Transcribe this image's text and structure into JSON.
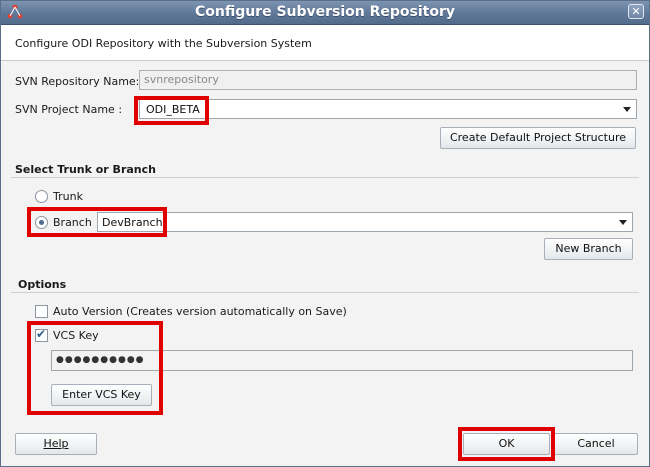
{
  "window": {
    "title": "Configure Subversion Repository",
    "close_glyph": "✕"
  },
  "header": {
    "description": "Configure ODI Repository with the Subversion System"
  },
  "repository": {
    "name_label": "SVN Repository Name:",
    "name_value": "svnrepository",
    "project_label": "SVN Project Name :",
    "project_value": "ODI_BETA",
    "create_structure_button": "Create Default Project Structure"
  },
  "trunk_branch": {
    "section_title": "Select Trunk or Branch",
    "trunk_label": "Trunk",
    "branch_label": "Branch",
    "branch_value": "DevBranch",
    "selected": "branch",
    "new_branch_button": "New Branch"
  },
  "options": {
    "section_title": "Options",
    "auto_version_label": "Auto Version (Creates version automatically on Save)",
    "auto_version_checked": false,
    "vcs_key_label": "VCS Key",
    "vcs_key_checked": true,
    "vcs_key_value": "●●●●●●●●●●",
    "enter_vcs_key_button": "Enter VCS Key"
  },
  "footer": {
    "help_button": "Help",
    "ok_button": "OK",
    "cancel_button": "Cancel"
  },
  "colors": {
    "highlight": "#e00000",
    "titlebar": "#5f7797"
  }
}
